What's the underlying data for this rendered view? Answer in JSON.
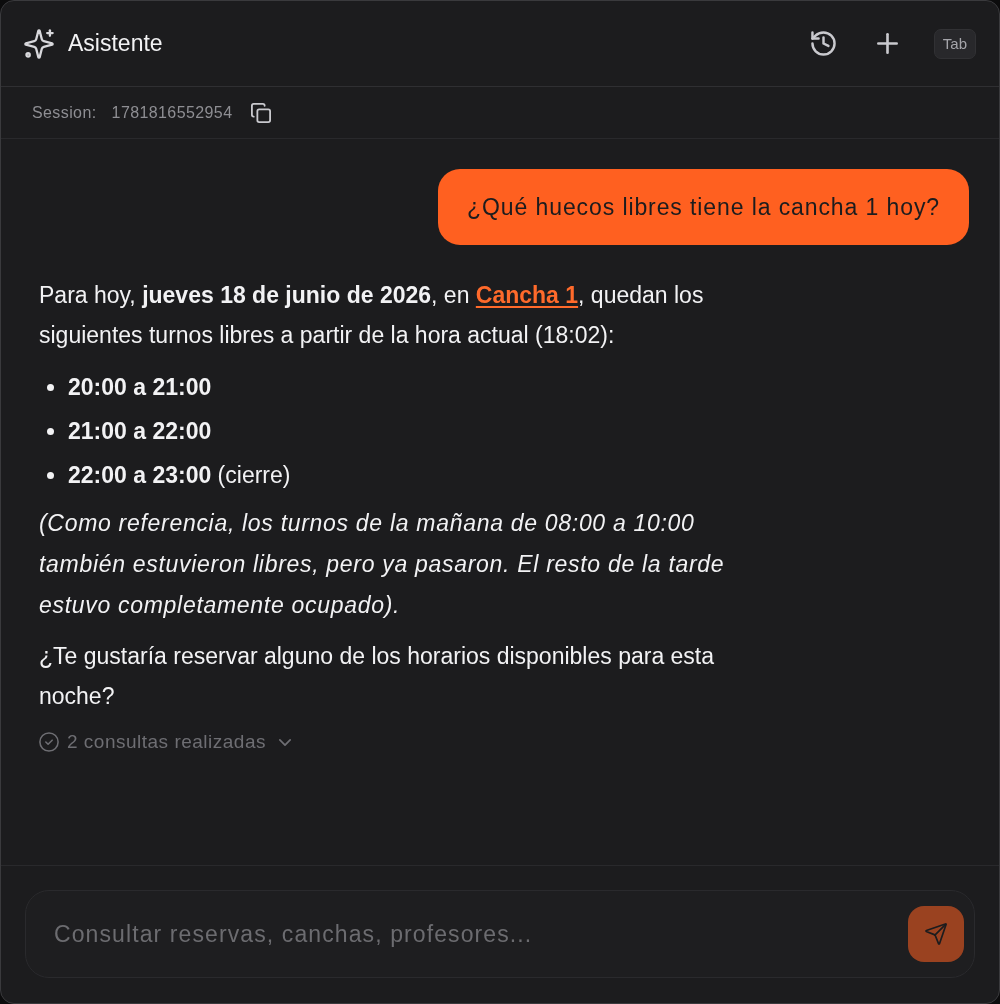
{
  "header": {
    "title": "Asistente",
    "shortcut": "Tab"
  },
  "session": {
    "label": "Session:",
    "id": "1781816552954"
  },
  "messages": [
    {
      "kind": "user",
      "text": "¿Qué huecos libres tiene la cancha 1 hoy?"
    },
    {
      "kind": "assistant",
      "blocks": [
        {
          "kind": "paragraph",
          "parts": [
            {
              "kind": "text",
              "text": "Para hoy, **jueves 18 de junio de 2026**, en "
            },
            {
              "kind": "link",
              "text": "Cancha 1"
            },
            {
              "kind": "text",
              "text": ", quedan los siguientes turnos libres a partir de la hora actual (18:02):"
            }
          ]
        },
        {
          "kind": "list",
          "items": [
            "**20:00 a 21:00**",
            "**21:00 a 22:00**",
            "**22:00 a 23:00** (cierre)"
          ]
        },
        {
          "kind": "note",
          "text": "(Como referencia, los turnos de la mañana de 08:00 a 10:00 también estuvieron libres, pero ya pasaron. El resto de la tarde estuvo completamente ocupado)."
        },
        {
          "kind": "paragraph",
          "parts": [
            {
              "kind": "text",
              "text": "¿Te gustaría reservar alguno de los horarios disponibles para esta noche?"
            }
          ]
        }
      ],
      "tools": {
        "summary": "2 consultas realizadas",
        "expanded": false
      }
    }
  ],
  "composer": {
    "placeholder": "Consultar reservas, canchas, profesores...",
    "send_disabled": true
  }
}
